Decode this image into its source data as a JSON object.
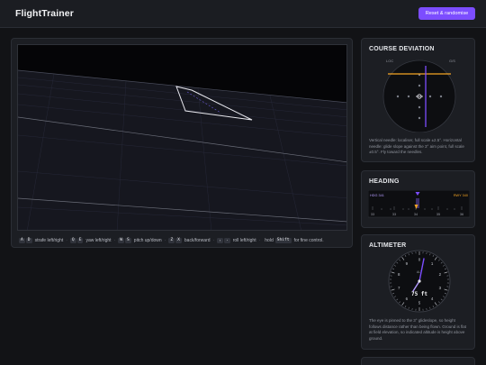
{
  "app": {
    "title": "FlightTrainer"
  },
  "header": {
    "reset_label": "Reset & randomise"
  },
  "scene": {},
  "controls": [
    {
      "keys": [
        "A",
        "D"
      ],
      "label": "strafe left/right"
    },
    {
      "keys": [
        "Q",
        "E"
      ],
      "label": "yaw left/right"
    },
    {
      "keys": [
        "W",
        "S"
      ],
      "label": "pitch up/down"
    },
    {
      "keys": [
        "Z",
        "X"
      ],
      "label": "back/forward"
    },
    {
      "keys": [
        ",",
        "."
      ],
      "label": "roll left/right"
    },
    {
      "prefix": "hold",
      "keys": [
        "Shift"
      ],
      "label": "for fine control."
    }
  ],
  "course_deviation": {
    "title": "COURSE DEVIATION",
    "left_tag": "LOC",
    "right_tag": "G/S",
    "note": "Vertical needle: localiser, full scale ±2.5°. Horizontal needle: glide slope against the 3° aim point, full scale ±0.5°. Fly toward the needles.",
    "accent_vertical": "#7c4dff",
    "accent_horizontal": "#f5a524"
  },
  "heading": {
    "title": "HEADING",
    "left_tag": "HDG 341",
    "right_tag": "RWY 340",
    "ticks": [
      "33",
      "33",
      "34",
      "35",
      "36"
    ]
  },
  "altimeter": {
    "title": "ALTIMETER",
    "readout": "75 ft",
    "dial_label": "ALT",
    "numbers": [
      "0",
      "1",
      "2",
      "3",
      "4",
      "5",
      "6",
      "7",
      "8",
      "9"
    ],
    "note": "The eye is pinned to the 3° glideslope, so height follows distance rather than being flown. Ground is flat at field elevation, so indicated altitude is height above ground."
  },
  "extra_panel": {
    "title": ""
  }
}
